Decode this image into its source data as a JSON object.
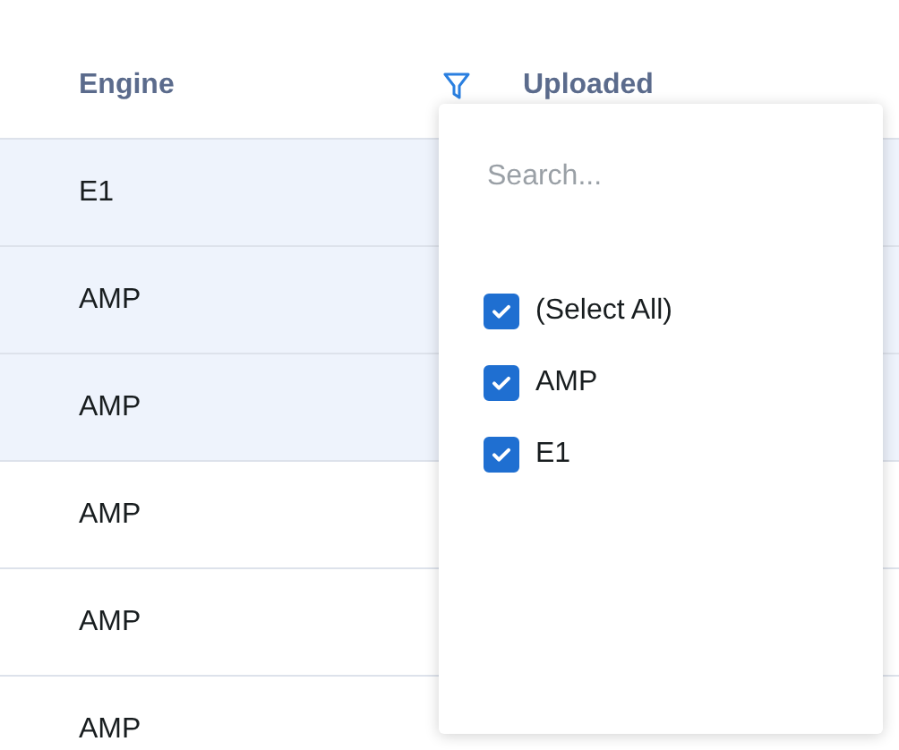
{
  "table": {
    "columns": [
      {
        "label": "Engine",
        "filter_active": true
      },
      {
        "label": "Uploaded",
        "filter_active": false
      }
    ],
    "rows": [
      {
        "engine": "E1",
        "selected": true
      },
      {
        "engine": "AMP",
        "selected": true
      },
      {
        "engine": "AMP",
        "selected": true
      },
      {
        "engine": "AMP",
        "selected": false
      },
      {
        "engine": "AMP",
        "selected": false
      },
      {
        "engine": "AMP",
        "selected": false
      }
    ]
  },
  "filter_menu": {
    "search": {
      "placeholder": "Search..."
    },
    "options": [
      {
        "label": "(Select All)",
        "checked": true
      },
      {
        "label": "AMP",
        "checked": true
      },
      {
        "label": "E1",
        "checked": true
      }
    ]
  }
}
